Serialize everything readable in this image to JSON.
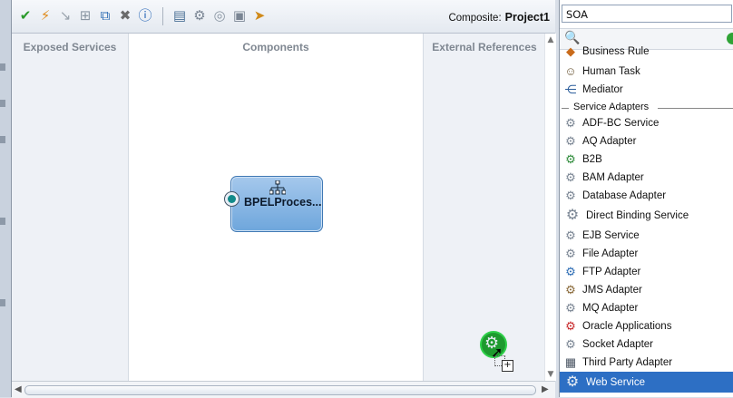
{
  "toolbar": {
    "composite_label": "Composite:",
    "project_name": "Project1"
  },
  "swimlanes": {
    "exposed_services": "Exposed Services",
    "components": "Components",
    "external_references": "External References"
  },
  "component": {
    "label": "BPELProces..."
  },
  "palette": {
    "selected_category": "SOA",
    "search_value": "",
    "top_items": [
      {
        "label": "Business Rule"
      },
      {
        "label": "Human Task"
      },
      {
        "label": "Mediator"
      }
    ],
    "section_title": "Service Adapters",
    "adapters": [
      {
        "label": "ADF-BC Service"
      },
      {
        "label": "AQ Adapter"
      },
      {
        "label": "B2B"
      },
      {
        "label": "BAM Adapter"
      },
      {
        "label": "Database Adapter"
      },
      {
        "label": "Direct Binding Service"
      },
      {
        "label": "EJB Service"
      },
      {
        "label": "File Adapter"
      },
      {
        "label": "FTP Adapter"
      },
      {
        "label": "JMS Adapter"
      },
      {
        "label": "MQ Adapter"
      },
      {
        "label": "Oracle Applications"
      },
      {
        "label": "Socket Adapter"
      },
      {
        "label": "Third Party Adapter"
      },
      {
        "label": "Web Service"
      }
    ]
  },
  "colors": {
    "selection": "#2d6fc4",
    "component_fill": "#8ab8e6",
    "drag_indicator": "#1d9a2e"
  }
}
